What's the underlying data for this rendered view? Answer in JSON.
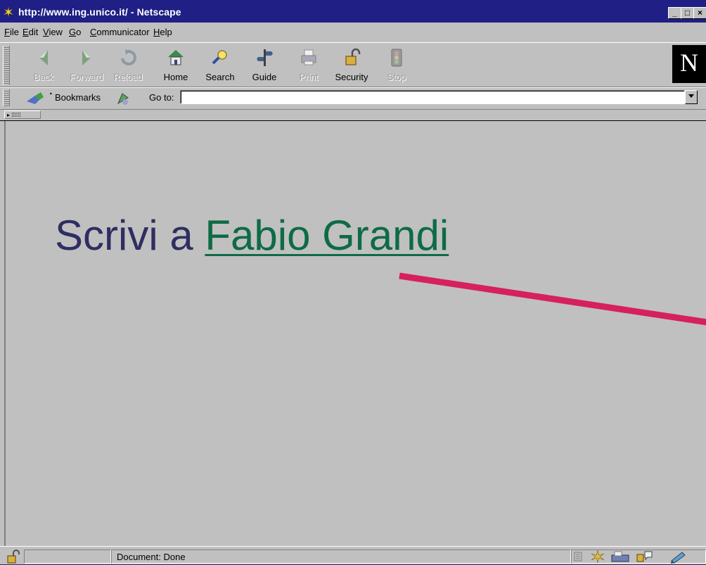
{
  "window": {
    "title": "http://www.ing.unico.it/ - Netscape",
    "controls": [
      "_",
      "□",
      "×"
    ]
  },
  "menu": {
    "items": [
      {
        "label": "File",
        "key": "F",
        "rest": "ile"
      },
      {
        "label": "Edit",
        "key": "E",
        "rest": "dit"
      },
      {
        "label": "View",
        "key": "V",
        "rest": "iew"
      },
      {
        "label": "Go",
        "key": "G",
        "rest": "o"
      },
      {
        "label": "Communicator",
        "key": "C",
        "rest": "ommunicator"
      },
      {
        "label": "Help",
        "key": "H",
        "rest": "elp"
      }
    ]
  },
  "toolbar": {
    "buttons": [
      {
        "label": "Back",
        "icon": "back-arrow-icon",
        "enabled": false
      },
      {
        "label": "Forward",
        "icon": "forward-arrow-icon",
        "enabled": false
      },
      {
        "label": "Reload",
        "icon": "reload-icon",
        "enabled": false
      },
      {
        "label": "Home",
        "icon": "home-icon",
        "enabled": true
      },
      {
        "label": "Search",
        "icon": "search-icon",
        "enabled": true
      },
      {
        "label": "Guide",
        "icon": "guide-icon",
        "enabled": true
      },
      {
        "label": "Print",
        "icon": "print-icon",
        "enabled": false
      },
      {
        "label": "Security",
        "icon": "padlock-icon",
        "enabled": true
      },
      {
        "label": "Stop",
        "icon": "stop-icon",
        "enabled": false
      }
    ],
    "brand_logo": "N"
  },
  "location": {
    "bookmarks_label": "Bookmarks",
    "goto_label": "Go to:",
    "url_value": ""
  },
  "content": {
    "heading_prefix": "Scrivi a ",
    "heading_link": "Fabio Grandi"
  },
  "status": {
    "text": "Document: Done"
  },
  "colors": {
    "titlebar": "#1f1f86",
    "chrome": "#c0c0c0",
    "heading_text": "#2e2e63",
    "link": "#0e6b45",
    "pointer_line": "#d6205f"
  }
}
